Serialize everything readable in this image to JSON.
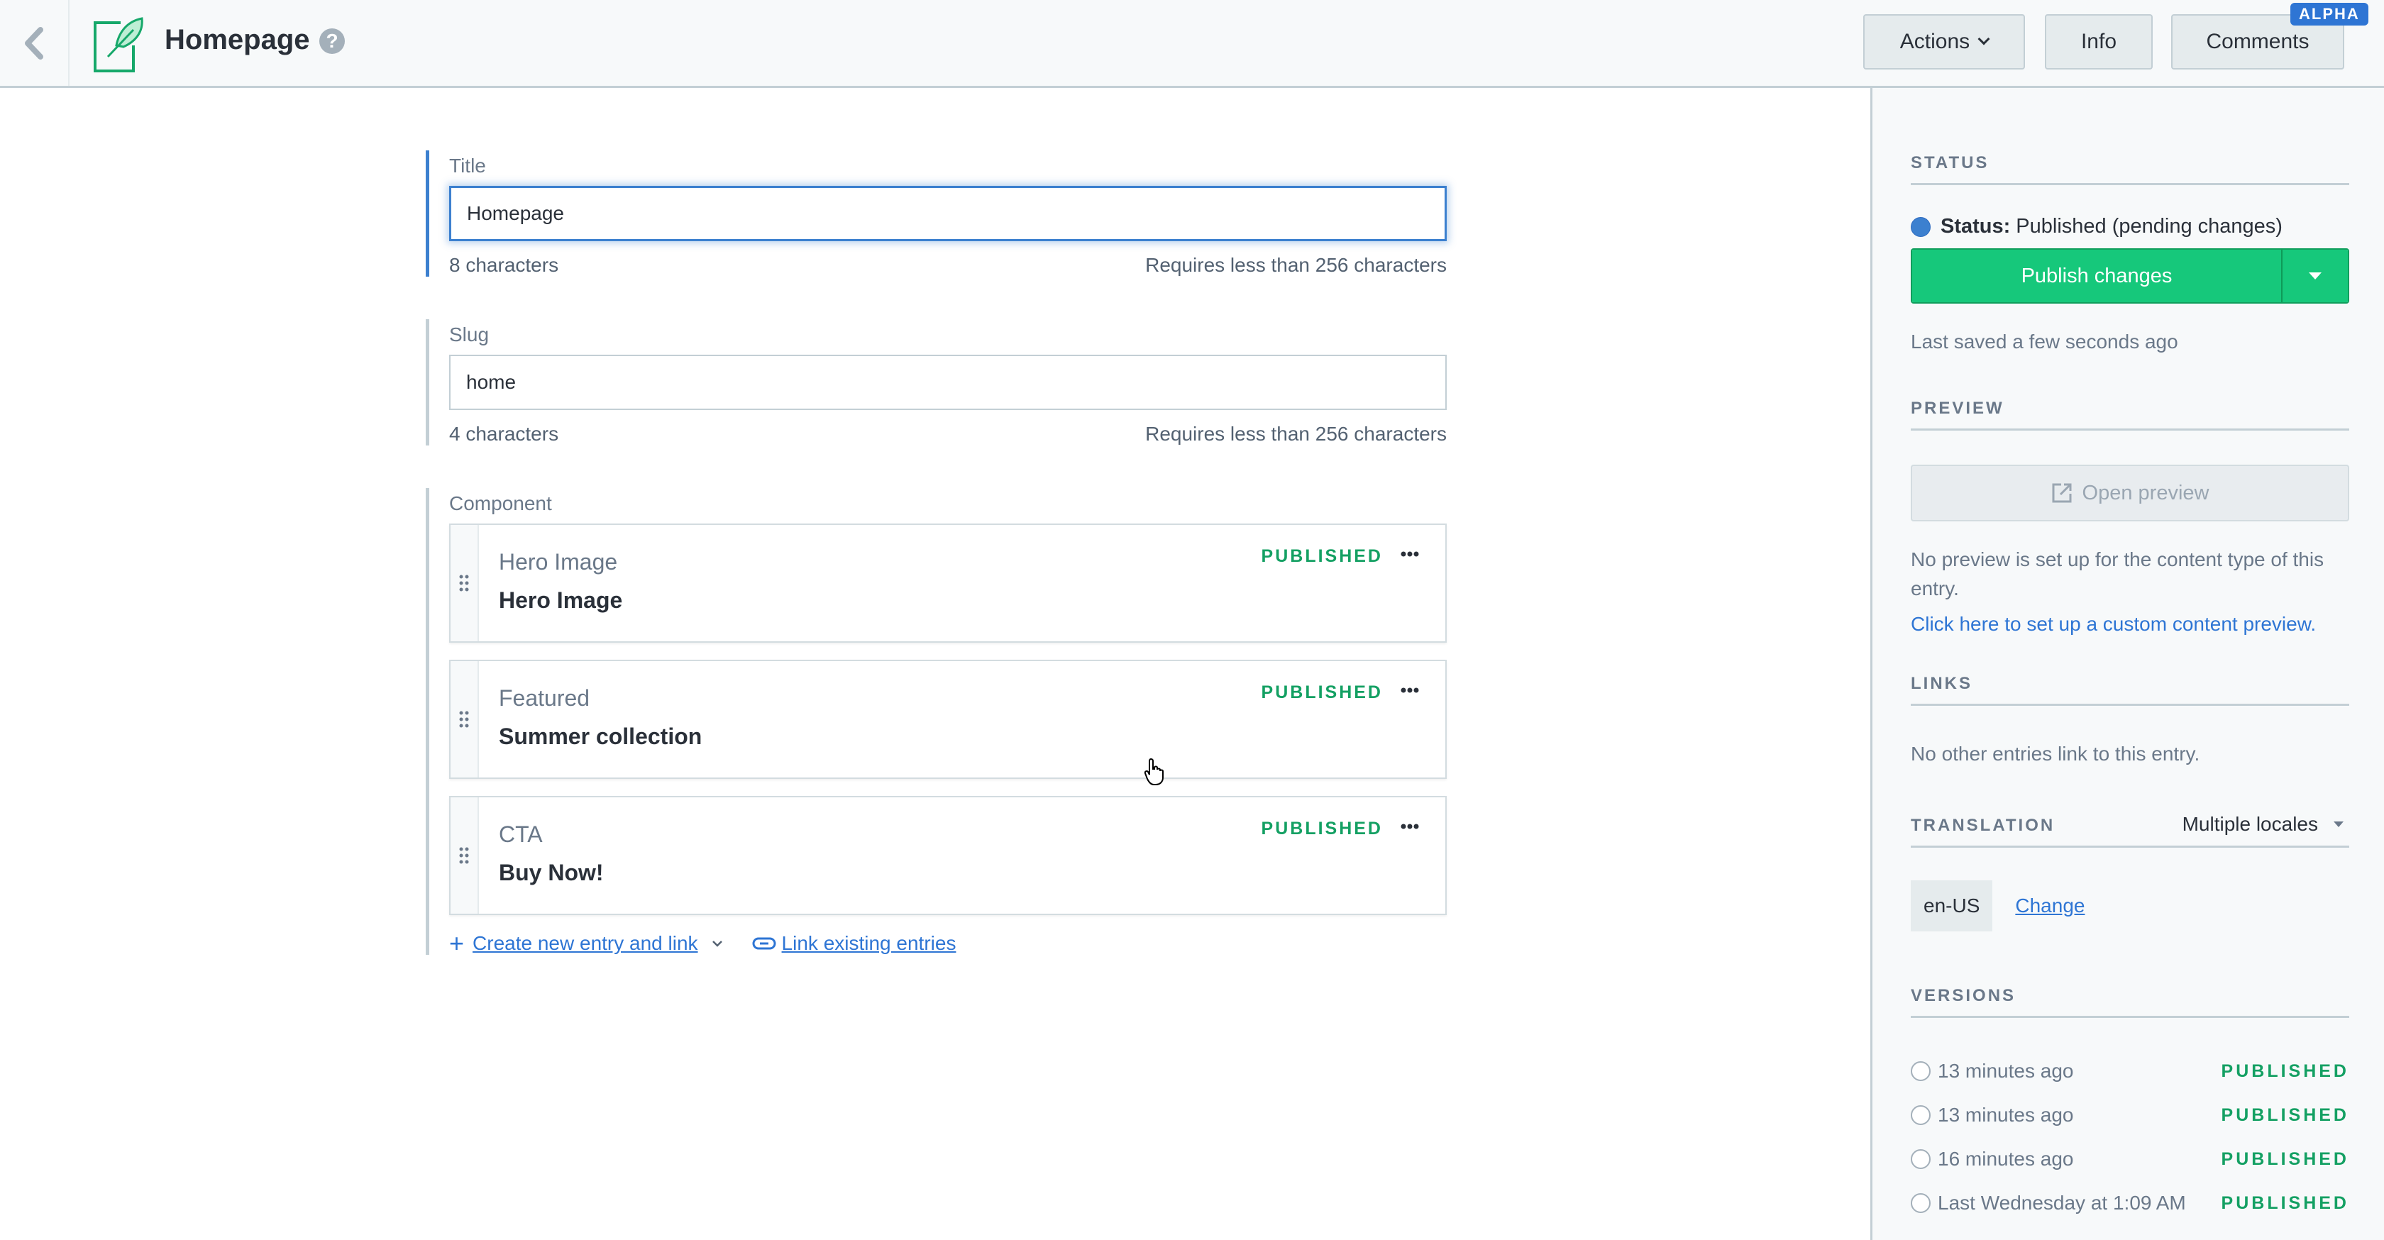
{
  "header": {
    "back_icon": "chevron-left-icon",
    "entry_icon": "feather-entry-icon",
    "title": "Homepage",
    "help_icon": "question-circle-icon",
    "actions_label": "Actions",
    "info_label": "Info",
    "comments_label": "Comments",
    "comments_badge": "ALPHA"
  },
  "fields": {
    "title": {
      "label": "Title",
      "value": "Homepage",
      "count": "8 characters",
      "hint": "Requires less than 256 characters"
    },
    "slug": {
      "label": "Slug",
      "value": "home",
      "count": "4 characters",
      "hint": "Requires less than 256 characters"
    },
    "component": {
      "label": "Component",
      "entries": [
        {
          "type": "Hero Image",
          "title": "Hero Image",
          "status": "PUBLISHED"
        },
        {
          "type": "Featured",
          "title": "Summer collection",
          "status": "PUBLISHED"
        },
        {
          "type": "CTA",
          "title": "Buy Now!",
          "status": "PUBLISHED"
        }
      ],
      "create_link": "Create new entry and link",
      "link_existing": "Link existing entries"
    }
  },
  "sidebar": {
    "status": {
      "heading": "STATUS",
      "label": "Status:",
      "value": "Published (pending changes)",
      "publish_button": "Publish changes",
      "last_saved": "Last saved a few seconds ago"
    },
    "preview": {
      "heading": "PREVIEW",
      "button": "Open preview",
      "note": "No preview is set up for the content type of this entry.",
      "setup_link": "Click here to set up a custom content preview."
    },
    "links": {
      "heading": "LINKS",
      "note": "No other entries link to this entry."
    },
    "translation": {
      "heading": "TRANSLATION",
      "mode": "Multiple locales",
      "locale": "en-US",
      "change_link": "Change"
    },
    "versions": {
      "heading": "VERSIONS",
      "items": [
        {
          "time": "13 minutes ago",
          "status": "PUBLISHED"
        },
        {
          "time": "13 minutes ago",
          "status": "PUBLISHED"
        },
        {
          "time": "16 minutes ago",
          "status": "PUBLISHED"
        },
        {
          "time": "Last Wednesday at 1:09 AM",
          "status": "PUBLISHED"
        }
      ]
    }
  },
  "colors": {
    "accent": "#3c80cf",
    "published": "#14a063",
    "publish_button": "#16c87b",
    "link": "#2e75d4"
  }
}
